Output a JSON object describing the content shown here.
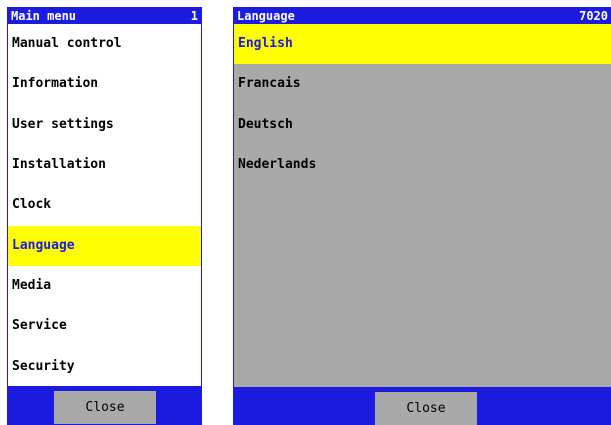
{
  "main_menu": {
    "title": "Main menu",
    "code": "1",
    "items": [
      {
        "label": "Manual control"
      },
      {
        "label": "Information"
      },
      {
        "label": "User settings"
      },
      {
        "label": "Installation"
      },
      {
        "label": "Clock"
      },
      {
        "label": "Language",
        "selected": true
      },
      {
        "label": "Media"
      },
      {
        "label": "Service"
      },
      {
        "label": "Security"
      }
    ],
    "close_label": "Close"
  },
  "language_menu": {
    "title": "Language",
    "code": "7020",
    "items": [
      {
        "label": "English",
        "selected": true
      },
      {
        "label": "Francais"
      },
      {
        "label": "Deutsch"
      },
      {
        "label": "Nederlands"
      }
    ],
    "close_label": "Close"
  },
  "colors": {
    "title_bar": "#1c1ce0",
    "selection": "#ffff00",
    "button": "#a9a9a9",
    "list_background_secondary": "#a9a9a9"
  }
}
